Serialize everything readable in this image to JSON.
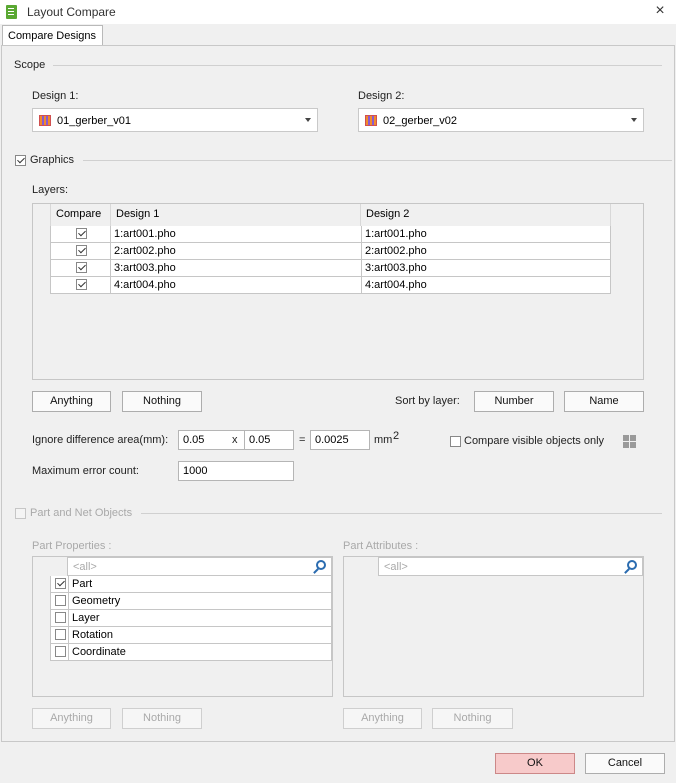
{
  "window": {
    "title": "Layout Compare"
  },
  "tabs": [
    {
      "label": "Compare Designs"
    }
  ],
  "scope": {
    "label": "Scope",
    "design1": {
      "label": "Design 1:",
      "value": "01_gerber_v01"
    },
    "design2": {
      "label": "Design 2:",
      "value": "02_gerber_v02"
    }
  },
  "graphics": {
    "label": "Graphics",
    "checked": true,
    "layers_label": "Layers:",
    "columns": [
      "Compare",
      "Design 1",
      "Design 2"
    ],
    "rows": [
      {
        "checked": true,
        "d1": "1:art001.pho",
        "d2": "1:art001.pho"
      },
      {
        "checked": true,
        "d1": "2:art002.pho",
        "d2": "2:art002.pho"
      },
      {
        "checked": true,
        "d1": "3:art003.pho",
        "d2": "3:art003.pho"
      },
      {
        "checked": true,
        "d1": "4:art004.pho",
        "d2": "4:art004.pho"
      }
    ],
    "anything": "Anything",
    "nothing": "Nothing",
    "sort_label": "Sort by layer:",
    "sort_number": "Number",
    "sort_name": "Name",
    "ignore_label": "Ignore difference area(mm):",
    "ignore_a": "0.05",
    "times": "x",
    "ignore_b": "0.05",
    "equals": "=",
    "ignore_result": "0.0025",
    "unit": "mm",
    "unit_sup": "2",
    "visible_only": "Compare visible objects only",
    "max_label": "Maximum error count:",
    "max_value": "1000"
  },
  "parts": {
    "label": "Part and Net Objects",
    "props_label": "Part Properties :",
    "attrs_label": "Part Attributes :",
    "filter_placeholder": "<all>",
    "props": [
      {
        "label": "Part",
        "checked": true
      },
      {
        "label": "Geometry",
        "checked": false
      },
      {
        "label": "Layer",
        "checked": false
      },
      {
        "label": "Rotation",
        "checked": false
      },
      {
        "label": "Coordinate",
        "checked": false
      }
    ],
    "anything": "Anything",
    "nothing": "Nothing"
  },
  "footer": {
    "ok": "OK",
    "cancel": "Cancel"
  }
}
